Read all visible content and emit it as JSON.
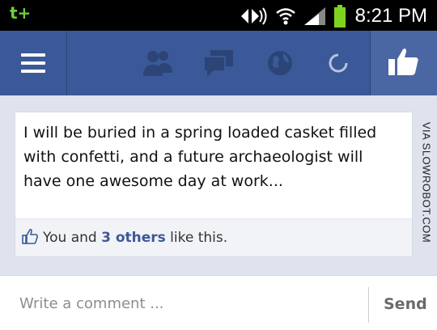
{
  "status_bar": {
    "carrier_icon": "t+",
    "time": "8:21 PM",
    "icons": [
      "sync-icon",
      "wifi-icon",
      "signal-icon",
      "battery-charging-icon"
    ]
  },
  "header": {
    "icons": [
      "menu-icon",
      "friend-requests-icon",
      "messages-icon",
      "notifications-icon",
      "loading-icon",
      "like-icon"
    ]
  },
  "post": {
    "text": "I will be buried in a spring loaded casket filled with confetti, and a future archaeologist will have one awesome day at work...",
    "likes_prefix": "You and ",
    "likes_others": "3 others",
    "likes_suffix": " like this."
  },
  "watermark": "VIA SLOWROBOT.COM",
  "comment": {
    "placeholder": "Write a comment ...",
    "send_label": "Send"
  },
  "colors": {
    "facebook_blue": "#3b5998",
    "background": "#dfe3ee"
  }
}
